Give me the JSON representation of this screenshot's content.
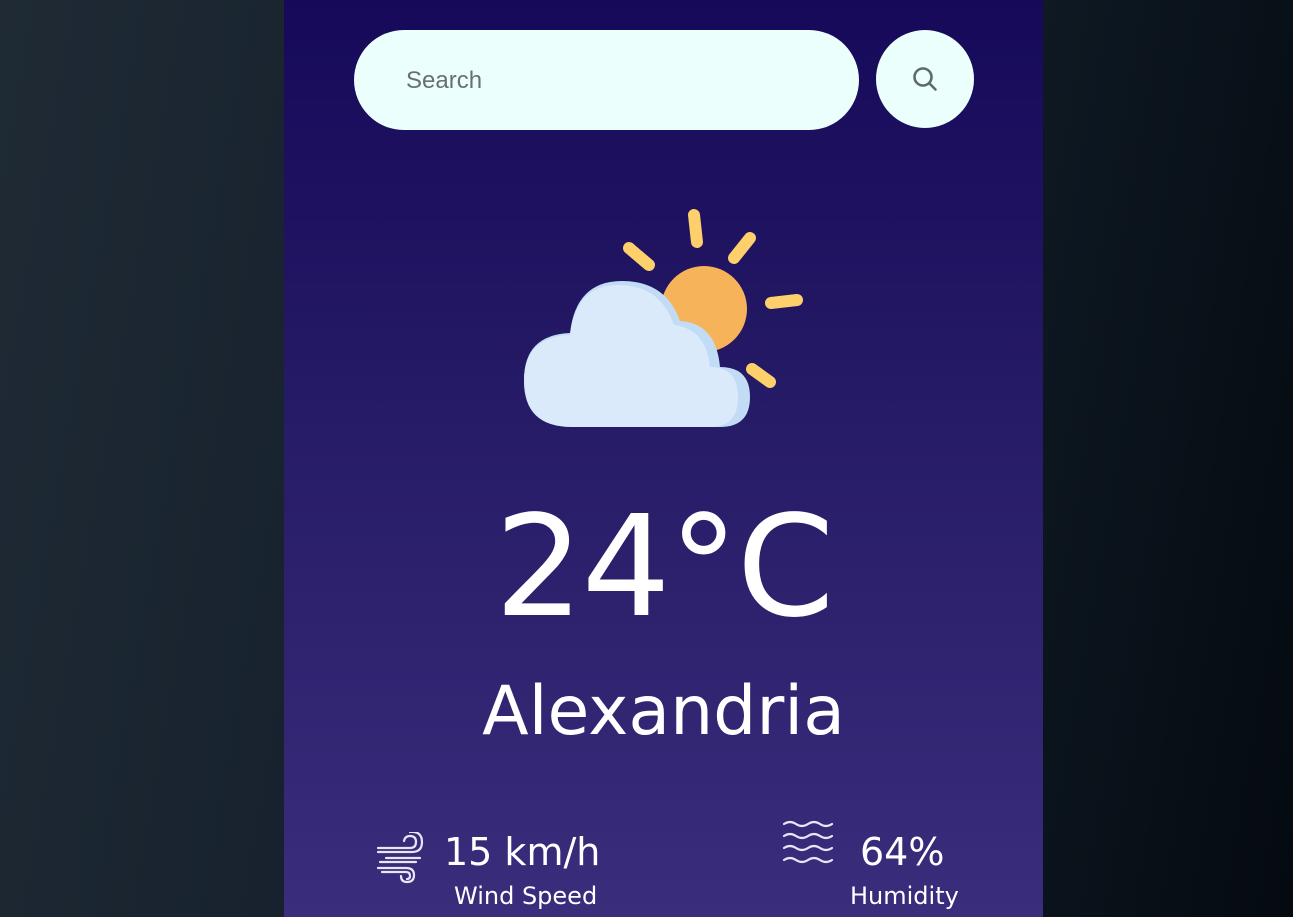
{
  "search": {
    "placeholder": "Search",
    "value": "",
    "button_icon": "search-icon"
  },
  "weather": {
    "condition_icon": "partly-cloudy-icon",
    "temperature": "24°C",
    "city": "Alexandria"
  },
  "details": {
    "wind": {
      "icon": "wind-icon",
      "value": "15 km/h",
      "label": "Wind Speed"
    },
    "humidity": {
      "icon": "humidity-icon",
      "value": "64%",
      "label": "Humidity"
    }
  },
  "colors": {
    "card_top": "#16095a",
    "card_bottom": "#3a2d7c",
    "search_bg": "#ebfffc",
    "sun": "#f6b35a",
    "sun_rays": "#fdd06b",
    "cloud": "#dbeafb",
    "cloud_shade": "#c3dcf6",
    "text": "#ffffff"
  }
}
